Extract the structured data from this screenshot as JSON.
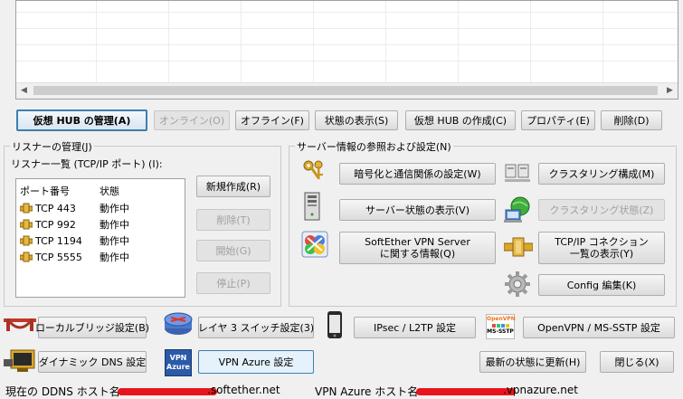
{
  "hub_buttons": {
    "manage": "仮想 HUB の管理(A)",
    "online": "オンライン(O)",
    "offline": "オフライン(F)",
    "status": "状態の表示(S)",
    "create": "仮想 HUB の作成(C)",
    "properties": "プロパティ(E)",
    "delete": "削除(D)"
  },
  "listener": {
    "group_title": "リスナーの管理(J)",
    "list_label": "リスナー一覧 (TCP/IP ポート) (I):",
    "col_port": "ポート番号",
    "col_state": "状態",
    "rows": [
      {
        "port": "TCP 443",
        "state": "動作中"
      },
      {
        "port": "TCP 992",
        "state": "動作中"
      },
      {
        "port": "TCP 1194",
        "state": "動作中"
      },
      {
        "port": "TCP 5555",
        "state": "動作中"
      }
    ],
    "new_button": "新規作成(R)",
    "delete_button": "削除(T)",
    "start_button": "開始(G)",
    "stop_button": "停止(P)"
  },
  "server_info": {
    "group_title": "サーバー情報の参照および設定(N)",
    "encryption_button": "暗号化と通信関係の設定(W)",
    "clustering_config_button": "クラスタリング構成(M)",
    "server_status_button": "サーバー状態の表示(V)",
    "clustering_status_button": "クラスタリング状態(Z)",
    "about_line1": "SoftEther VPN Server",
    "about_line2": "に関する情報(Q)",
    "tcpip_line1": "TCP/IP コネクション",
    "tcpip_line2": "一覧の表示(Y)",
    "config_edit_button": "Config 編集(K)"
  },
  "bottom": {
    "local_bridge_button": "ローカルブリッジ設定(B)",
    "layer3_button": "レイヤ 3 スイッチ設定(3)",
    "ipsec_button": "IPsec / L2TP 設定",
    "openvpn_button": "OpenVPN / MS-SSTP 設定",
    "ddns_button": "ダイナミック DNS 設定",
    "vpn_azure_button": "VPN Azure 設定",
    "refresh_button": "最新の状態に更新(H)",
    "close_button": "閉じる(X)",
    "openvpn_icon_label": "OpenVPN",
    "mssstp_icon_label": "MS-SSTP",
    "vpn_icon_line1": "VPN",
    "vpn_icon_line2": "Azure"
  },
  "status_bar": {
    "ddns_label": "現在の DDNS ホスト名:",
    "ddns_suffix": ".softether.net",
    "azure_label": "VPN Azure ホスト名:",
    "azure_suffix": ".vpnazure.net"
  },
  "colors": {
    "accent": "#3c7fb1",
    "redaction": "#e8141c"
  },
  "icons": [
    "keys-icon",
    "clustered-servers-icon",
    "server-tower-icon",
    "network-globe-icon",
    "softether-logo-icon",
    "network-pipe-icon",
    "gear-icon",
    "bridge-icon",
    "router-icon",
    "phone-icon",
    "openvpn-logo-icon",
    "monitor-icon",
    "vpn-azure-icon",
    "port-connector-icon"
  ]
}
